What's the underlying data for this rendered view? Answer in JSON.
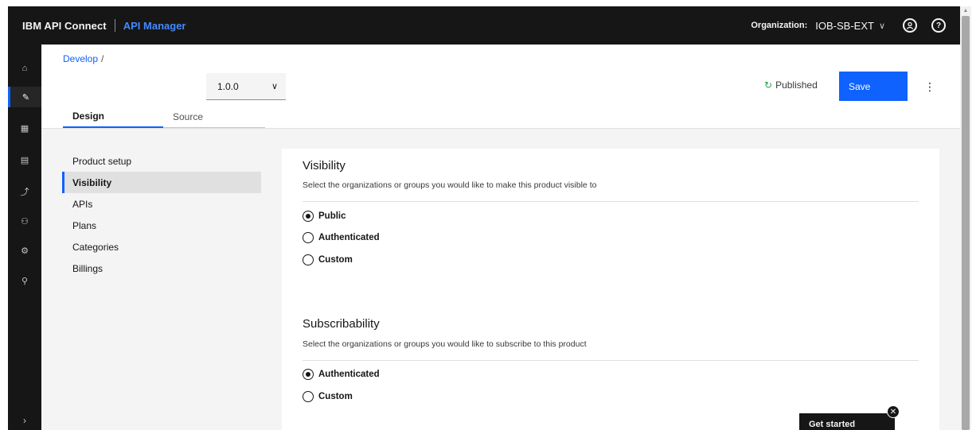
{
  "topbar": {
    "brand": "IBM API Connect",
    "app": "API Manager",
    "org_label": "Organization:",
    "org_value": "IOB-SB-EXT",
    "org_chevron": "∨",
    "user_icon": "user-avatar-icon",
    "help_icon": "help-icon"
  },
  "sidenav": {
    "items": [
      {
        "icon": "home-icon",
        "glyph": "⌂"
      },
      {
        "icon": "develop-pencil-icon",
        "glyph": "✎"
      },
      {
        "icon": "manage-grid-icon",
        "glyph": "▦"
      },
      {
        "icon": "catalog-icon",
        "glyph": "▤"
      },
      {
        "icon": "analytics-icon",
        "glyph": "⤴"
      },
      {
        "icon": "members-icon",
        "glyph": "⚇"
      },
      {
        "icon": "settings-gear-icon",
        "glyph": "⚙"
      },
      {
        "icon": "search-icon",
        "glyph": "⚲"
      }
    ],
    "expand_glyph": "›"
  },
  "header": {
    "breadcrumb": "Develop",
    "breadcrumb_sep": "/",
    "version": "1.0.0",
    "version_chevron": "∨",
    "tabs": {
      "design": "Design",
      "source": "Source"
    },
    "status": "Published",
    "status_glyph": "↻",
    "save_label": "Save",
    "overflow_glyph": "⋮"
  },
  "leftnav": {
    "items": [
      "Product setup",
      "Visibility",
      "APIs",
      "Plans",
      "Categories",
      "Billings"
    ],
    "active": "Visibility"
  },
  "visibility": {
    "title": "Visibility",
    "description": "Select the organizations or groups you would like to make this product visible to",
    "options": [
      "Public",
      "Authenticated",
      "Custom"
    ],
    "selected": "Public"
  },
  "subscribability": {
    "title": "Subscribability",
    "description": "Select the organizations or groups you would like to subscribe to this product",
    "options": [
      "Authenticated",
      "Custom"
    ],
    "selected": "Authenticated"
  },
  "get_started": {
    "label": "Get started",
    "close_glyph": "✕"
  },
  "colors": {
    "accent": "#0f62fe",
    "shell": "#161616",
    "published": "#24a148"
  }
}
